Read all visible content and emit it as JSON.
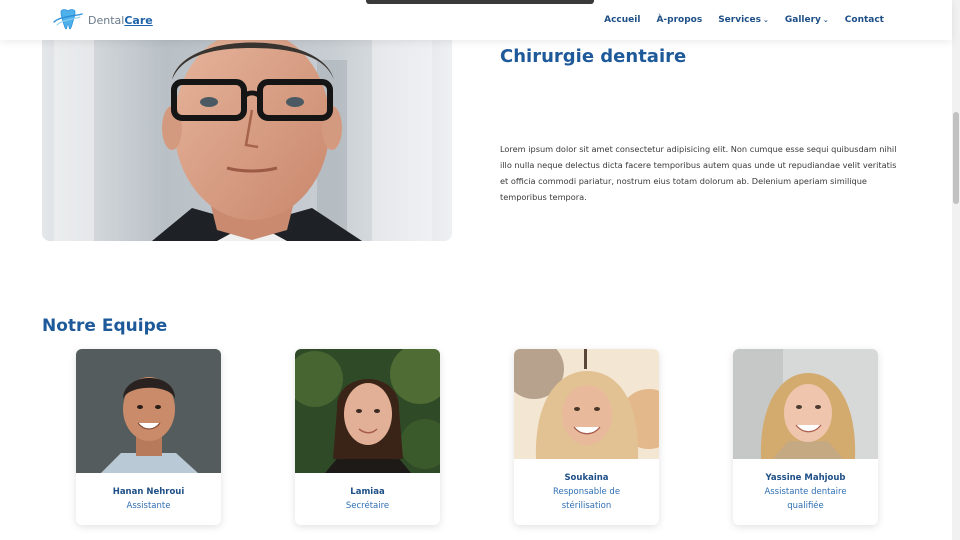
{
  "header": {
    "logo": {
      "brand_plain": "Dental",
      "brand_bold": "Care"
    },
    "nav": [
      {
        "label": "Accueil",
        "dropdown": false
      },
      {
        "label": "À-propos",
        "dropdown": false
      },
      {
        "label": "Services",
        "dropdown": true
      },
      {
        "label": "Gallery",
        "dropdown": true
      },
      {
        "label": "Contact",
        "dropdown": false
      }
    ]
  },
  "hero": {
    "title": "Chirurgie dentaire",
    "text": "Lorem ipsum dolor sit amet consectetur adipisicing elit. Non cumque esse sequi quibusdam nihil illo nulla neque delectus dicta facere temporibus autem quas unde ut repudiandae velit veritatis et officia commodi pariatur, nostrum eius totam dolorum ab. Delenium aperiam similique temporibus tempora."
  },
  "team": {
    "title": "Notre Equipe",
    "members": [
      {
        "name": "Hanan Nehroui",
        "role": "Assistante"
      },
      {
        "name": "Lamiaa",
        "role": "Secrétaire"
      },
      {
        "name": "Soukaina",
        "role": "Responsable de stérilisation"
      },
      {
        "name": "Yassine Mahjoub",
        "role": "Assistante dentaire qualifiée"
      }
    ]
  },
  "colors": {
    "brand": "#1e5a9a",
    "nav": "#1e4f86",
    "role": "#2f6fb4",
    "logo_accent": "#2b8fd9"
  },
  "icons": [
    "tooth-logo-icon",
    "chevron-down-icon"
  ]
}
